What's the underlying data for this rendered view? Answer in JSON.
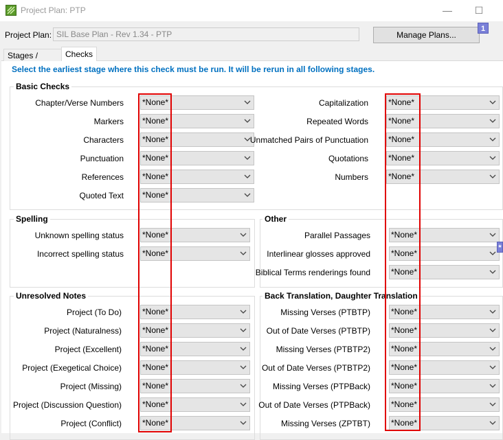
{
  "window": {
    "title": "Project Plan: PTP"
  },
  "header": {
    "plan_label": "Project Plan:",
    "plan_value": "SIL Base Plan - Rev 1.34 - PTP",
    "manage_button": "Manage Plans...",
    "badge": "1",
    "side_badge": "*"
  },
  "tabs": [
    {
      "label": "Stages / Tasks",
      "active": false
    },
    {
      "label": "Checks",
      "active": true
    }
  ],
  "instruction": "Select the earliest stage where this check must be run. It will be rerun in all following stages.",
  "groups": {
    "basic": {
      "title": "Basic Checks",
      "left": [
        {
          "label": "Chapter/Verse Numbers",
          "value": "*None*"
        },
        {
          "label": "Markers",
          "value": "*None*"
        },
        {
          "label": "Characters",
          "value": "*None*"
        },
        {
          "label": "Punctuation",
          "value": "*None*"
        },
        {
          "label": "References",
          "value": "*None*"
        },
        {
          "label": "Quoted Text",
          "value": "*None*"
        }
      ],
      "right": [
        {
          "label": "Capitalization",
          "value": "*None*"
        },
        {
          "label": "Repeated Words",
          "value": "*None*"
        },
        {
          "label": "Unmatched Pairs of Punctuation",
          "value": "*None*"
        },
        {
          "label": "Quotations",
          "value": "*None*"
        },
        {
          "label": "Numbers",
          "value": "*None*"
        }
      ]
    },
    "spelling": {
      "title": "Spelling",
      "rows": [
        {
          "label": "Unknown spelling status",
          "value": "*None*"
        },
        {
          "label": "Incorrect spelling status",
          "value": "*None*"
        }
      ]
    },
    "other": {
      "title": "Other",
      "rows": [
        {
          "label": "Parallel Passages",
          "value": "*None*"
        },
        {
          "label": "Interlinear glosses approved",
          "value": "*None*"
        },
        {
          "label": "Biblical Terms renderings found",
          "value": "*None*"
        }
      ]
    },
    "notes": {
      "title": "Unresolved Notes",
      "rows": [
        {
          "label": "Project (To Do)",
          "value": "*None*"
        },
        {
          "label": "Project (Naturalness)",
          "value": "*None*"
        },
        {
          "label": "Project (Excellent)",
          "value": "*None*"
        },
        {
          "label": "Project (Exegetical Choice)",
          "value": "*None*"
        },
        {
          "label": "Project (Missing)",
          "value": "*None*"
        },
        {
          "label": "Project (Discussion Question)",
          "value": "*None*"
        },
        {
          "label": "Project (Conflict)",
          "value": "*None*"
        }
      ]
    },
    "backtranslation": {
      "title": "Back Translation, Daughter Translation",
      "rows": [
        {
          "label": "Missing Verses (PTBTP)",
          "value": "*None*"
        },
        {
          "label": "Out of Date Verses (PTBTP)",
          "value": "*None*"
        },
        {
          "label": "Missing Verses (PTBTP2)",
          "value": "*None*"
        },
        {
          "label": "Out of Date Verses (PTBTP2)",
          "value": "*None*"
        },
        {
          "label": "Missing Verses (PTPBack)",
          "value": "*None*"
        },
        {
          "label": "Out of Date Verses (PTPBack)",
          "value": "*None*"
        },
        {
          "label": "Missing Verses (ZPTBT)",
          "value": "*None*"
        }
      ]
    }
  }
}
